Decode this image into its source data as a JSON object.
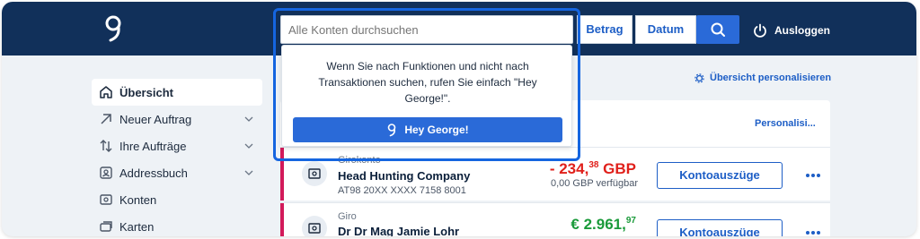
{
  "search": {
    "placeholder": "Alle Konten durchsuchen",
    "amount_filter": "Betrag",
    "date_filter": "Datum",
    "button_icon": "search-icon"
  },
  "header": {
    "logout_label": "Ausloggen",
    "logout_icon": "power-icon",
    "logo_icon": "george-logo-icon"
  },
  "dropdown": {
    "message": "Wenn Sie nach Funktionen und nicht nach Transaktionen suchen, rufen Sie einfach \"Hey George!\".",
    "button_label": "Hey George!"
  },
  "sidebar": {
    "items": [
      {
        "label": "Übersicht",
        "icon": "home-icon",
        "active": true
      },
      {
        "label": "Neuer Auftrag",
        "icon": "arrow-up-right-icon"
      },
      {
        "label": "Ihre Aufträge",
        "icon": "transfer-arrows-icon"
      },
      {
        "label": "Addressbuch",
        "icon": "contact-card-icon"
      },
      {
        "label": "Konten",
        "icon": "account-icon"
      },
      {
        "label": "Karten",
        "icon": "cards-icon"
      }
    ]
  },
  "main": {
    "personalise_overview": "Übersicht personalisieren",
    "card_personalise": "Personalisi...",
    "accounts": [
      {
        "type": "Girokonto",
        "name": "Head Hunting Company",
        "iban": "AT98 20XX XXXX 7158 8001",
        "amount_main": "- 234,",
        "amount_cents": "38",
        "amount_currency": " GBP",
        "available": "0,00 GBP verfügbar",
        "statement_label": "Kontoauszüge",
        "amount_color": "#e0201b"
      },
      {
        "type": "Giro",
        "name": "Dr Dr Mag Jamie Lohr",
        "amount_main": "€ 2.961,",
        "amount_cents": "97",
        "statement_label": "Kontoauszüge",
        "amount_color": "#1a9a3a"
      }
    ]
  },
  "colors": {
    "navy": "#11305a",
    "accent": "#2a6ad8",
    "link": "#1d5ec6",
    "highlight": "#1565e0"
  }
}
